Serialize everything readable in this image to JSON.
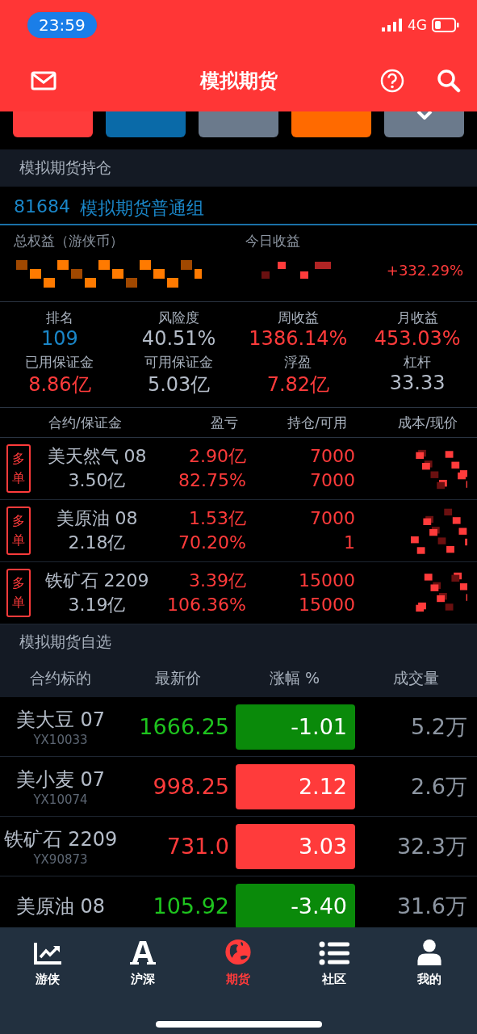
{
  "status_bar": {
    "time": "23:59",
    "network": "4G"
  },
  "header": {
    "title": "模拟期货"
  },
  "quick_buttons": [
    {
      "color": "#ff3b3b",
      "kind": "plain"
    },
    {
      "color": "#0a6aa8",
      "kind": "plain"
    },
    {
      "color": "#6b7a8c",
      "kind": "plain"
    },
    {
      "color": "#ff6a00",
      "kind": "plain"
    },
    {
      "color": "#6b7a8c",
      "kind": "more"
    }
  ],
  "holdings_section": {
    "title": "模拟期货持仓"
  },
  "account": {
    "id": "81684",
    "group": "模拟期货普通组",
    "equity_label": "总权益（游侠币）",
    "today_label": "今日收益",
    "equity_redacted": true,
    "today_redacted": true,
    "today_pct": "+332.29%"
  },
  "stats": [
    {
      "label": "排名",
      "value": "109",
      "color": "#1a86c8"
    },
    {
      "label": "风险度",
      "value": "40.51%",
      "color": "#b4bcc8"
    },
    {
      "label": "周收益",
      "value": "1386.14%",
      "color": "#ff3b3b"
    },
    {
      "label": "月收益",
      "value": "453.03%",
      "color": "#ff3b3b"
    },
    {
      "label": "已用保证金",
      "value": "8.86亿",
      "color": "#ff3b3b"
    },
    {
      "label": "可用保证金",
      "value": "5.03亿",
      "color": "#b4bcc8"
    },
    {
      "label": "浮盈",
      "value": "7.82亿",
      "color": "#ff3b3b"
    },
    {
      "label": "杠杆",
      "value": "33.33",
      "color": "#b4bcc8"
    }
  ],
  "positions": {
    "columns": [
      "合约/保证金",
      "盈亏",
      "持仓/可用",
      "成本/现价"
    ],
    "rows": [
      {
        "side": "多单",
        "name": "美天然气 08",
        "margin": "3.50亿",
        "pnl": "2.90亿",
        "pnl_pct": "82.75%",
        "hold": "7000",
        "available": "7000",
        "price_redacted": true
      },
      {
        "side": "多单",
        "name": "美原油 08",
        "margin": "2.18亿",
        "pnl": "1.53亿",
        "pnl_pct": "70.20%",
        "hold": "7000",
        "available": "1",
        "price_redacted": true
      },
      {
        "side": "多单",
        "name": "铁矿石 2209",
        "margin": "3.19亿",
        "pnl": "3.39亿",
        "pnl_pct": "106.36%",
        "hold": "15000",
        "available": "15000",
        "price_redacted": true
      }
    ]
  },
  "watchlist_section": {
    "title": "模拟期货自选"
  },
  "watchlist": {
    "columns": [
      "合约标的",
      "最新价",
      "涨幅 %",
      "成交量"
    ],
    "rows": [
      {
        "name": "美大豆 07",
        "code": "YX10033",
        "price": "1666.25",
        "change": "-1.01",
        "volume": "5.2万",
        "rising": false
      },
      {
        "name": "美小麦 07",
        "code": "YX10074",
        "price": "998.25",
        "change": "2.12",
        "volume": "2.6万",
        "rising": true
      },
      {
        "name": "铁矿石 2209",
        "code": "YX90873",
        "price": "731.0",
        "change": "3.03",
        "volume": "32.3万",
        "rising": true
      },
      {
        "name": "美原油 08",
        "price": "105.92",
        "change": "-3.40",
        "volume": "31.6万",
        "rising": false
      }
    ]
  },
  "tab_bar": [
    {
      "label": "游侠",
      "selected": false
    },
    {
      "label": "沪深",
      "selected": false
    },
    {
      "label": "期货",
      "selected": true
    },
    {
      "label": "社区",
      "selected": false
    },
    {
      "label": "我的",
      "selected": false
    }
  ]
}
